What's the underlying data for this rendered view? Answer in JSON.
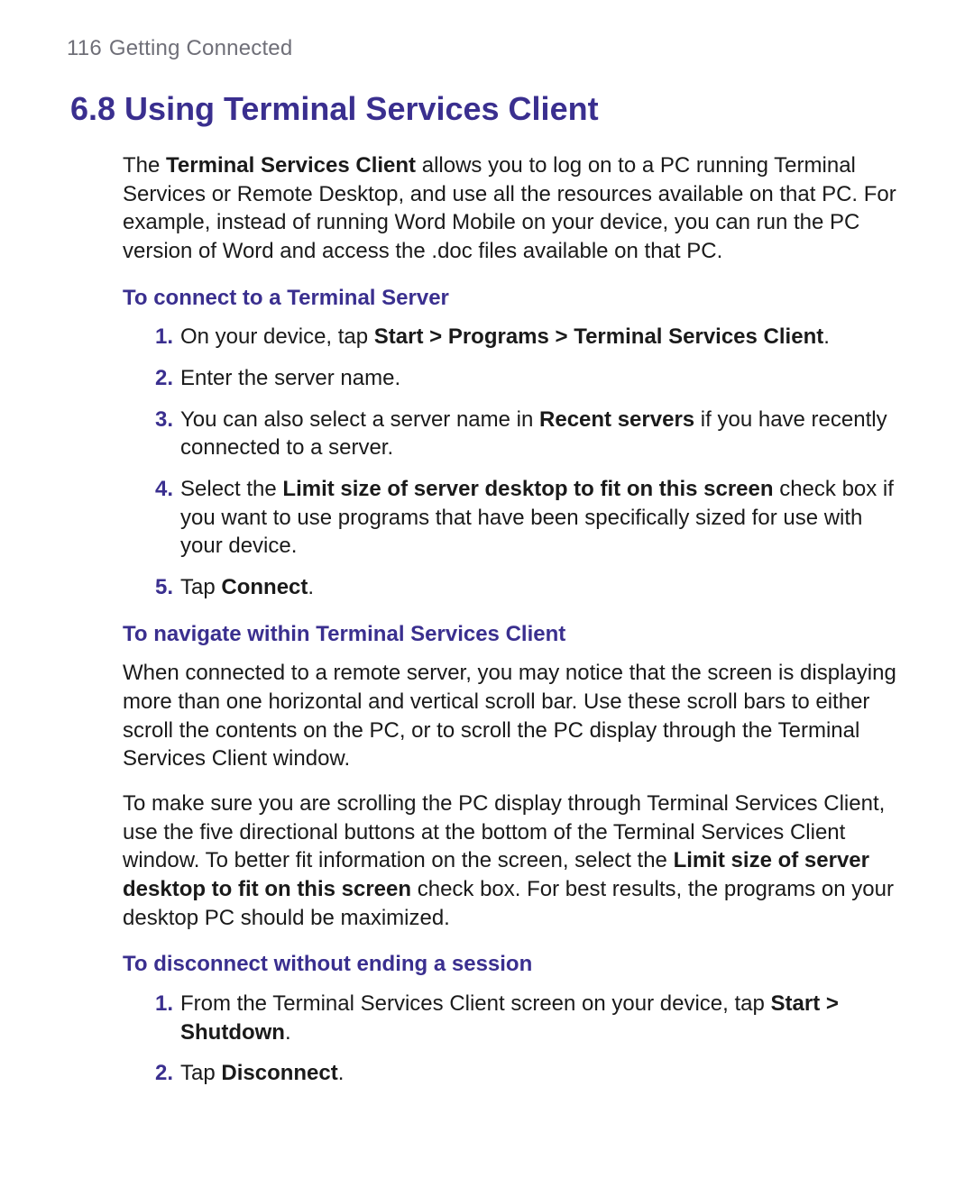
{
  "header": {
    "page_number": "116",
    "chapter": "Getting Connected"
  },
  "title": "6.8 Using Terminal Services Client",
  "intro": {
    "p1_a": "The ",
    "p1_b": "Terminal Services Client",
    "p1_c": " allows you to log on to a PC running Terminal Services or Remote Desktop, and use all the resources available on that PC. For example, instead of running Word Mobile on your device, you can run the PC version of Word and access the .doc files available on that PC."
  },
  "sec1": {
    "heading": "To connect to a Terminal Server",
    "steps": [
      {
        "n": "1",
        "a": "On your device, tap ",
        "b": "Start > Programs > Terminal Services Client",
        "c": "."
      },
      {
        "n": "2",
        "a": "Enter the server name.",
        "b": "",
        "c": ""
      },
      {
        "n": "3",
        "a": "You can also select a server name in ",
        "b": "Recent servers",
        "c": " if you have recently connected to a server."
      },
      {
        "n": "4",
        "a": "Select the ",
        "b": "Limit size of server desktop to fit on this screen",
        "c": " check box if you want to use programs that have been specifically sized for use with your device."
      },
      {
        "n": "5",
        "a": "Tap ",
        "b": "Connect",
        "c": "."
      }
    ]
  },
  "sec2": {
    "heading": "To navigate within Terminal Services Client",
    "p1": "When connected to a remote server, you may notice that the screen is displaying more than one horizontal and vertical scroll bar. Use these scroll bars to either scroll the contents on the PC, or to scroll the PC display through the Terminal Services Client window.",
    "p2_a": "To make sure you are scrolling the PC display through Terminal Services Client, use the five directional buttons at the bottom of the Terminal Services Client window. To better fit information on the screen, select the ",
    "p2_b": "Limit size of server desktop to fit on this screen",
    "p2_c": " check box. For best results, the programs on your desktop PC should be maximized."
  },
  "sec3": {
    "heading": "To disconnect without ending a session",
    "steps": [
      {
        "n": "1",
        "a": "From the Terminal Services Client screen on your device, tap ",
        "b": "Start > Shutdown",
        "c": "."
      },
      {
        "n": "2",
        "a": "Tap ",
        "b": "Disconnect",
        "c": "."
      }
    ]
  }
}
